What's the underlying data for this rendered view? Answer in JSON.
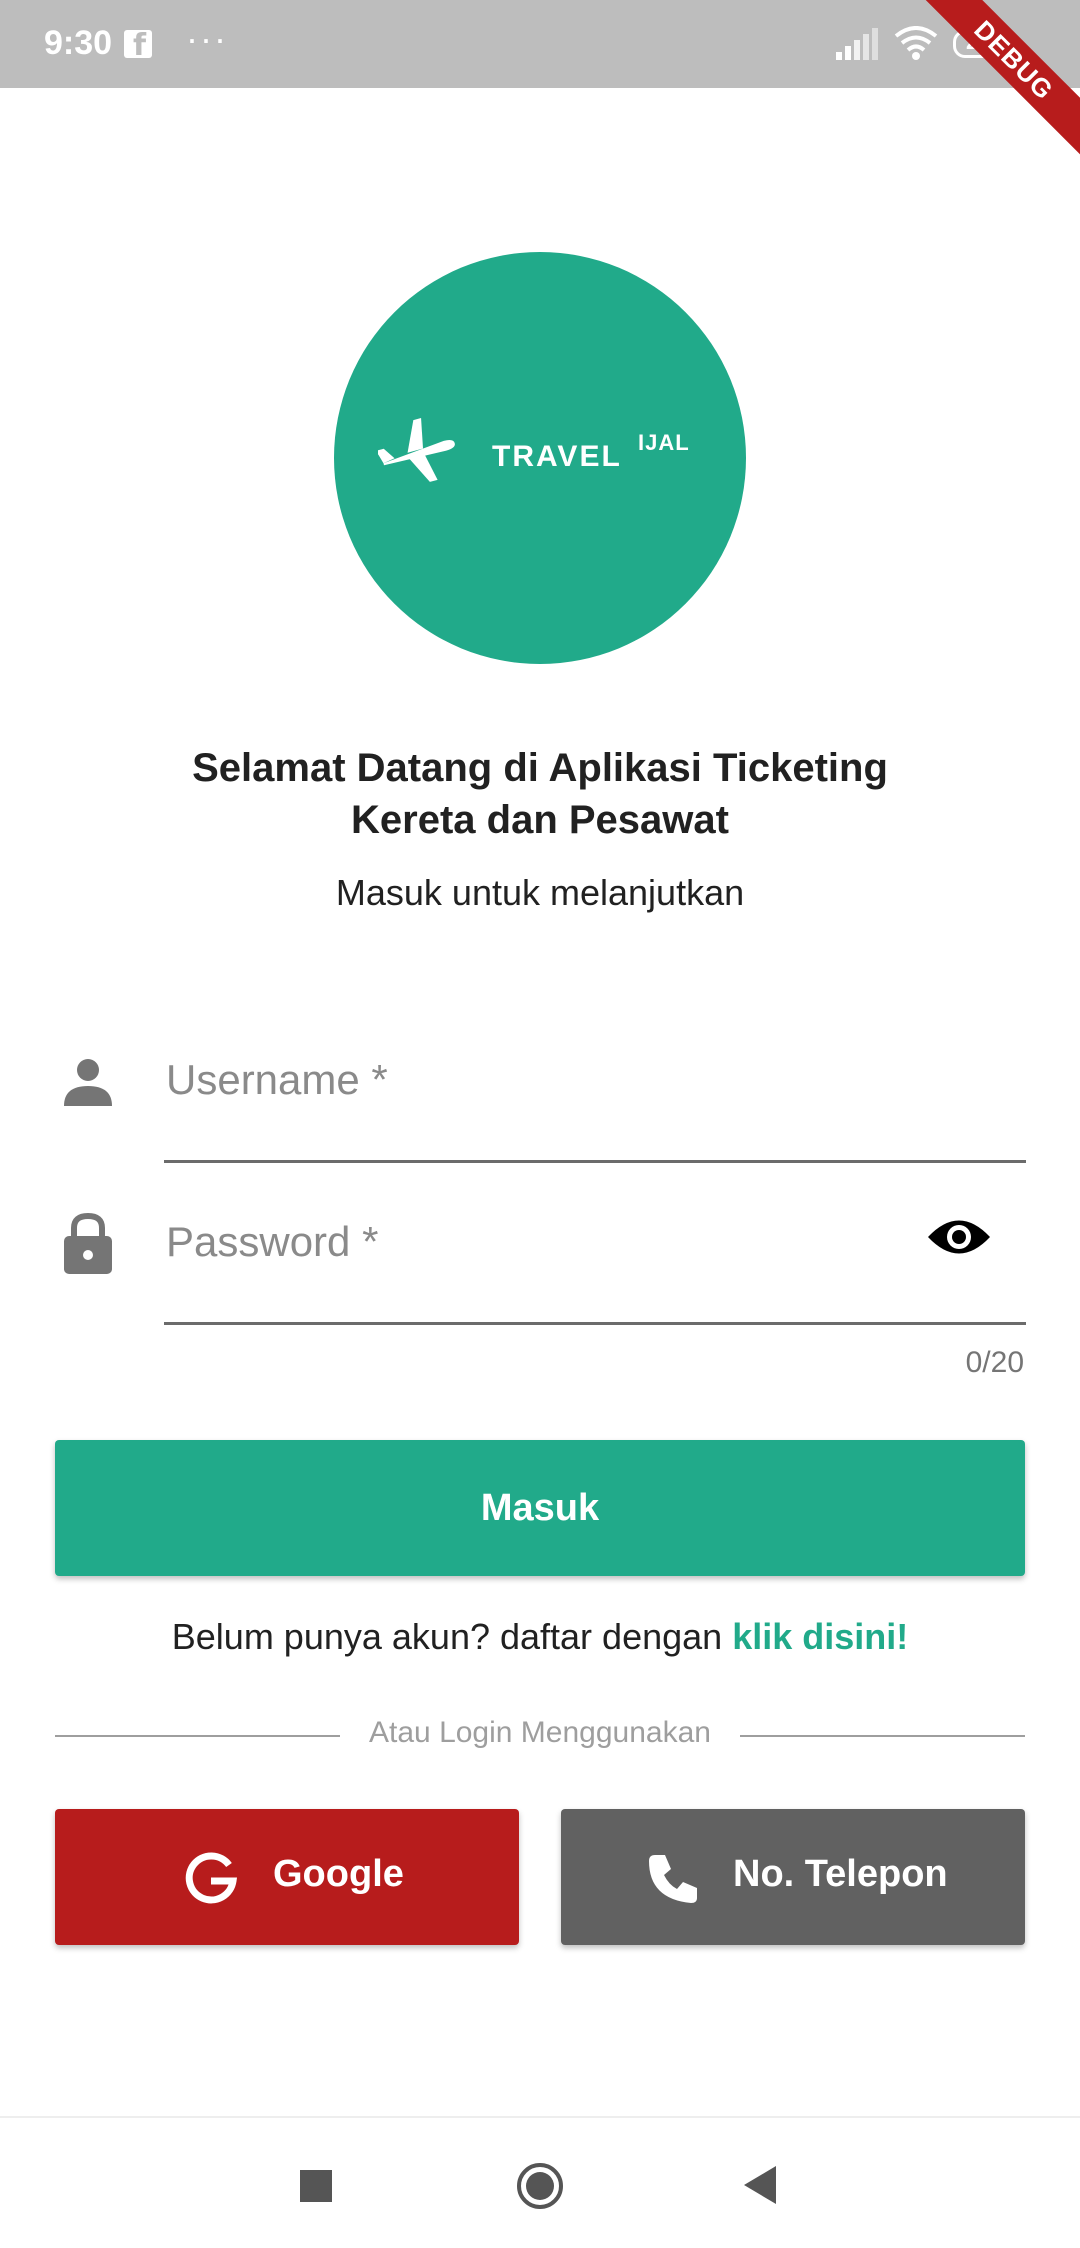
{
  "status_bar": {
    "time": "9:30",
    "facebook_glyph": "f",
    "dots": "···",
    "battery": "27",
    "debug_label": "DEBUG"
  },
  "logo": {
    "text": "TRAVEL",
    "superscript": "IJAL",
    "icon": "airplane-icon",
    "color": "#21aa8a"
  },
  "header": {
    "title_line1": "Selamat Datang di Aplikasi Ticketing",
    "title_line2": "Kereta dan Pesawat",
    "subtitle": "Masuk untuk melanjutkan"
  },
  "form": {
    "username_label": "Username *",
    "password_label": "Password *",
    "password_counter": "0/20",
    "username_icon": "person-icon",
    "password_icon": "lock-icon",
    "visibility_icon": "eye-icon"
  },
  "actions": {
    "login_label": "Masuk",
    "register_prompt": "Belum punya akun? daftar dengan ",
    "register_link": "klik disini!",
    "divider_text": "Atau Login Menggunakan",
    "google_label": "Google",
    "phone_label": "No. Telepon"
  },
  "colors": {
    "accent": "#21aa8a",
    "google_button": "#b71c1c",
    "phone_button": "#616161"
  }
}
